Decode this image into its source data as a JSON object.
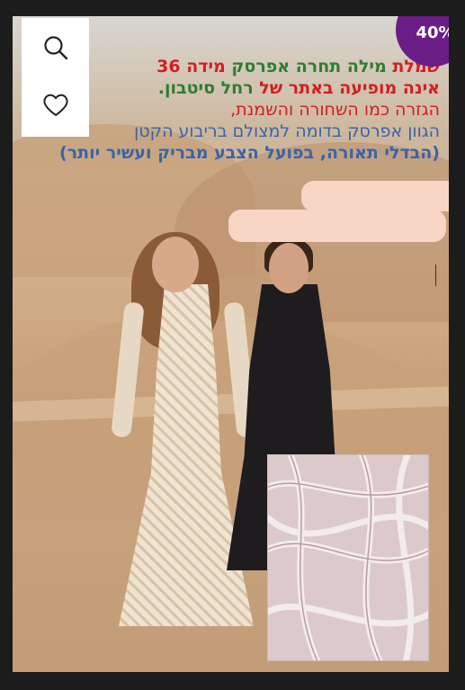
{
  "badge": {
    "label": "40%"
  },
  "icons": {
    "search": "search-icon",
    "favorite": "heart-icon"
  },
  "overlay": {
    "line1": {
      "part1": "שמלת ",
      "part2": "מילה תחרה אפרסק",
      "part3": " מידה 36"
    },
    "line2": {
      "part1": "אינה מופיעה באתר של ",
      "part2": "רחל סיטבון."
    },
    "line3": {
      "text": "הגזרה כמו השחורה והשמנת,"
    },
    "line4": {
      "text": "הגוון אפרסק בדומה למצולם בריבוע הקטן"
    },
    "line5": {
      "text": "(הבדלי תאורה, בפועל הצבע מבריק ועשיר יותר)"
    }
  },
  "colors": {
    "accent_red": "#d11f1f",
    "accent_green": "#2e7d32",
    "accent_blue": "#3a63a8",
    "badge_purple": "#6a1d86"
  }
}
